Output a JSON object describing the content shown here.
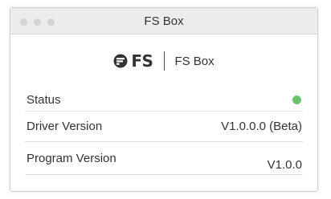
{
  "window": {
    "title": "FS Box"
  },
  "brand": {
    "logo_text": "FS",
    "app_name": "FS Box"
  },
  "rows": [
    {
      "label": "Status",
      "value": "",
      "status_color": "#6cc36c"
    },
    {
      "label": "Driver Version",
      "value": "V1.0.0.0 (Beta)"
    },
    {
      "label": "Program Version",
      "value": "V1.0.0"
    }
  ],
  "colors": {
    "status_online": "#6cc36c",
    "window_controls": "#d4d4d4"
  }
}
